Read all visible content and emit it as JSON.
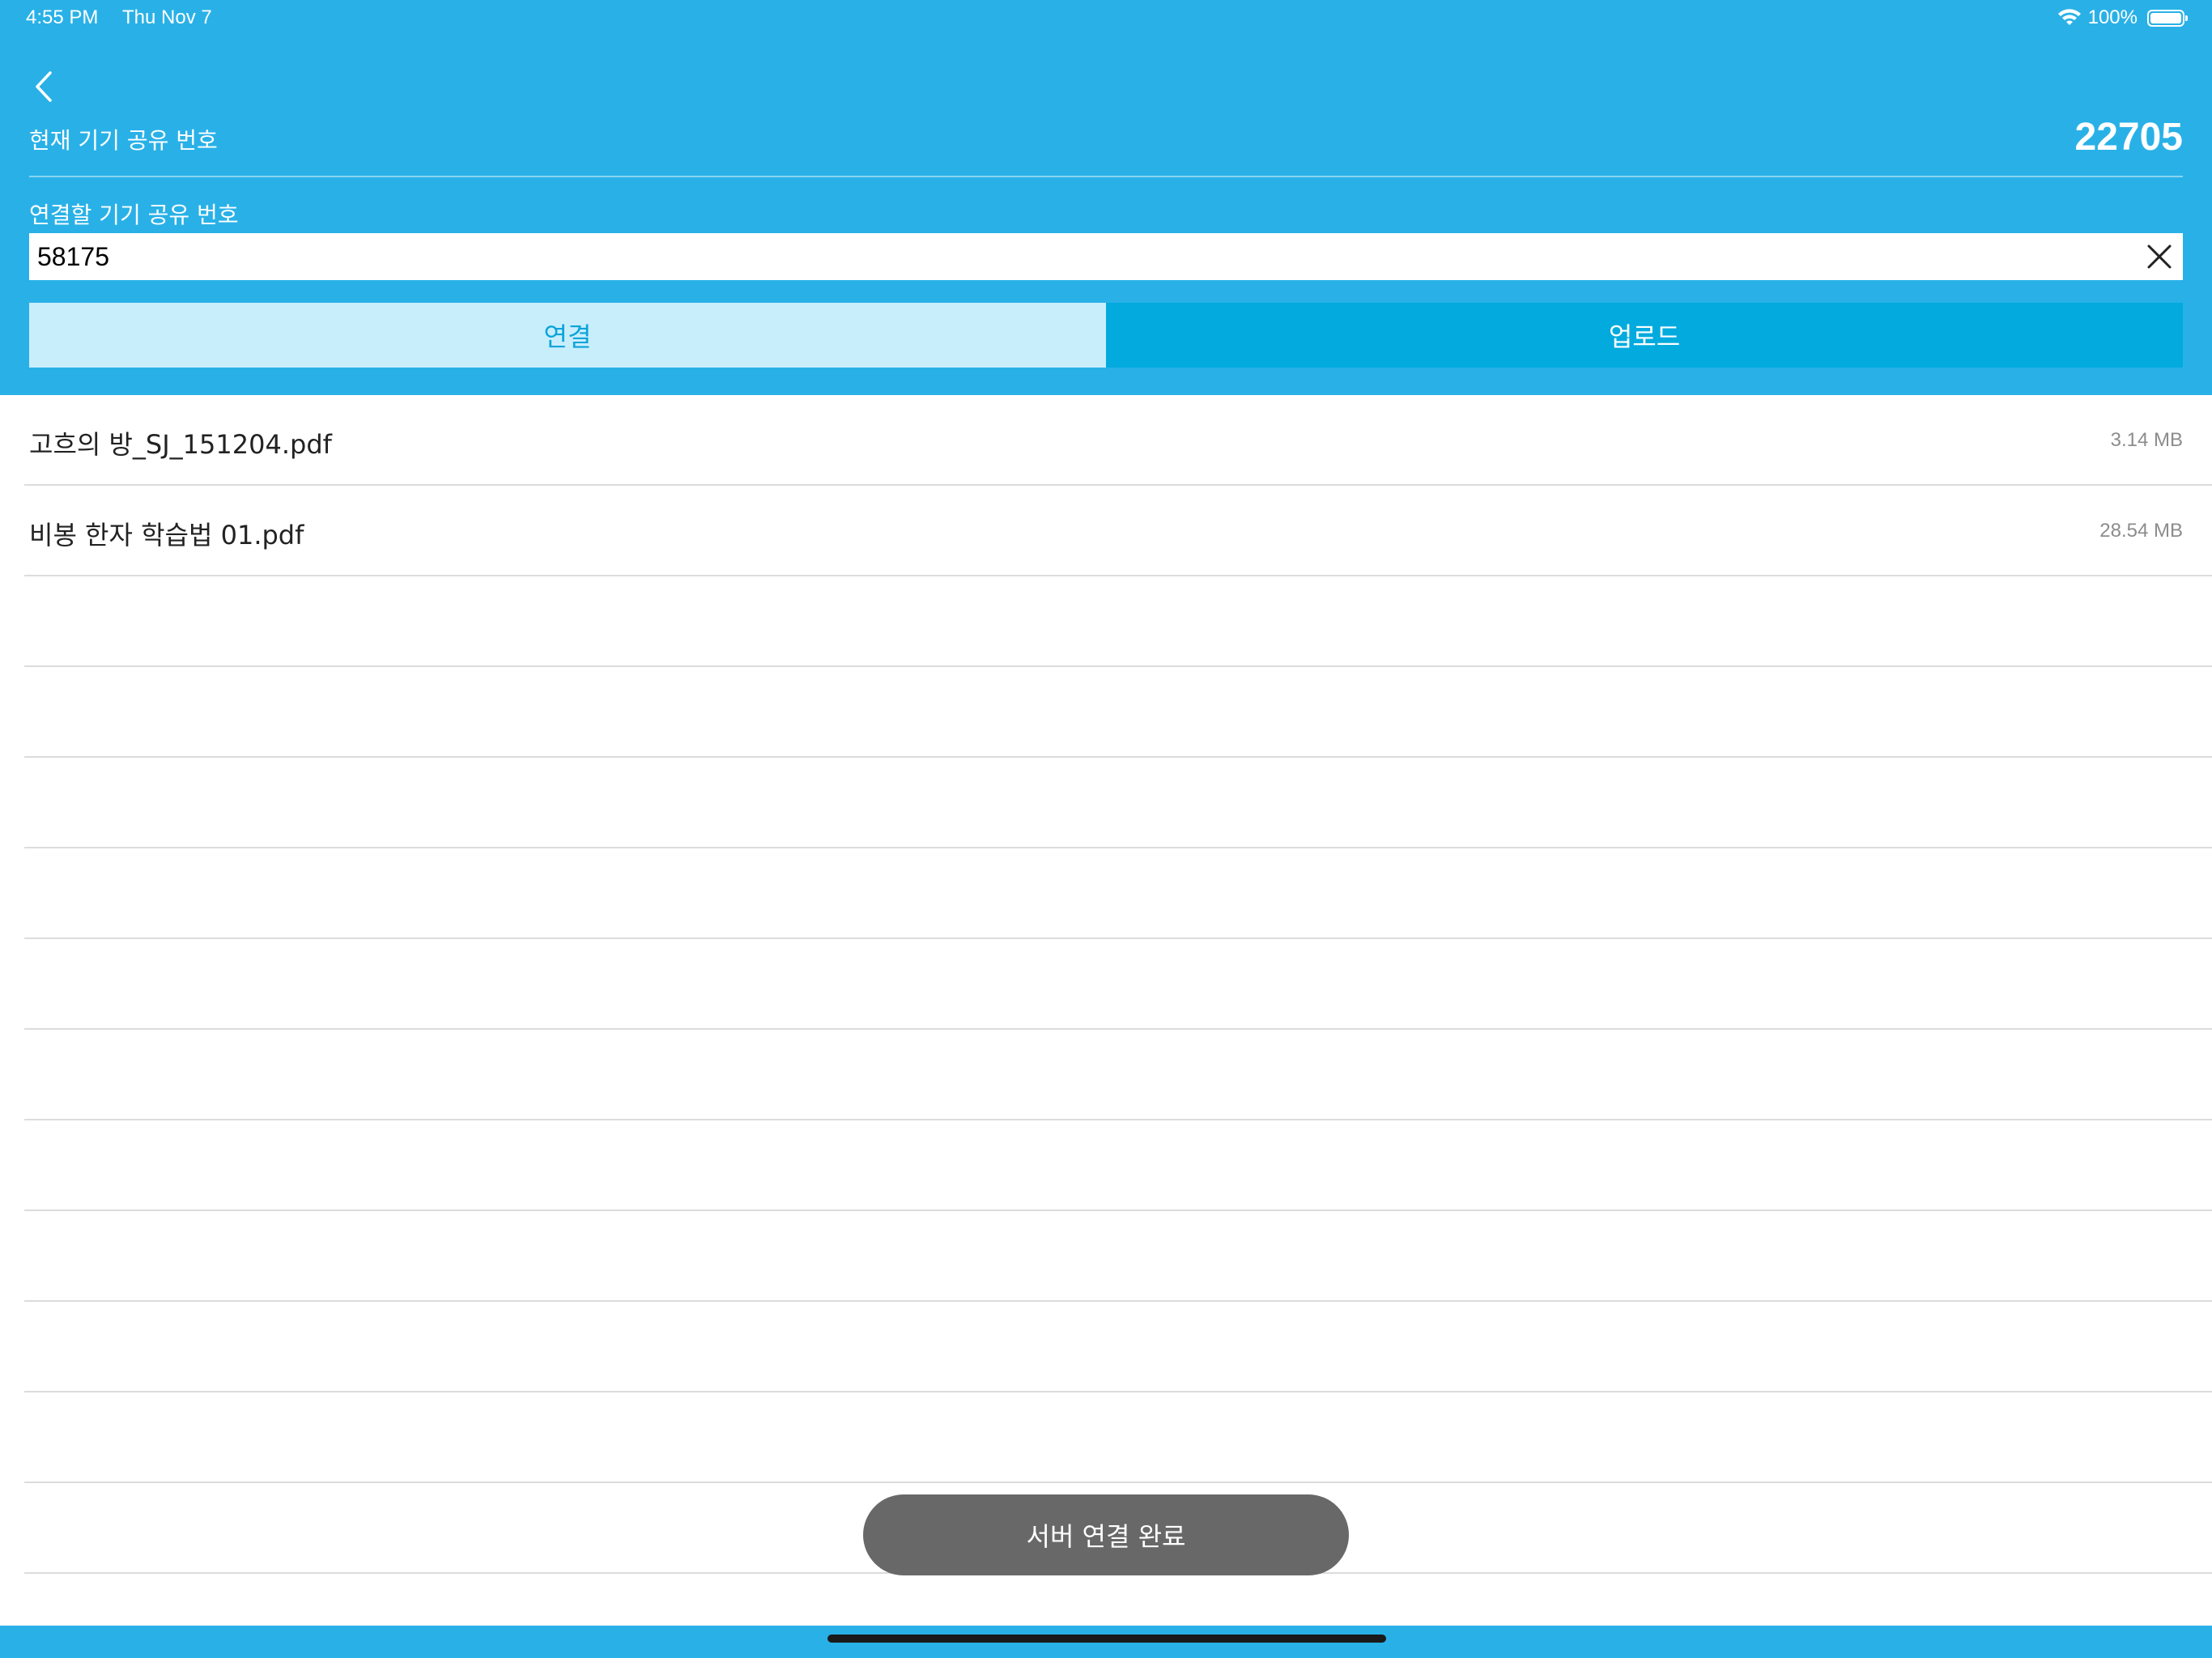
{
  "status_bar": {
    "time": "4:55 PM",
    "date": "Thu Nov 7",
    "battery": "100%"
  },
  "header": {
    "current_label": "현재 기기 공유 번호",
    "current_value": "22705",
    "target_label": "연결할 기기 공유 번호",
    "target_input_value": "58175"
  },
  "tabs": {
    "connect_label": "연결",
    "upload_label": "업로드"
  },
  "files": [
    {
      "name": "고흐의 방_SJ_151204.pdf",
      "size": "3.14 MB"
    },
    {
      "name": "비봉 한자 학습법 01.pdf",
      "size": "28.54 MB"
    }
  ],
  "toast": {
    "message": "서버 연결 완료"
  },
  "icons": {
    "back": "chevron-left-icon",
    "clear": "close-icon",
    "wifi": "wifi-icon",
    "battery": "battery-icon"
  },
  "colors": {
    "header_bg": "#29b1e7",
    "connect_tab_bg": "#c8eefc",
    "connect_tab_text": "#0aa4d9",
    "upload_tab_bg": "#02aade",
    "toast_bg": "#686868"
  }
}
